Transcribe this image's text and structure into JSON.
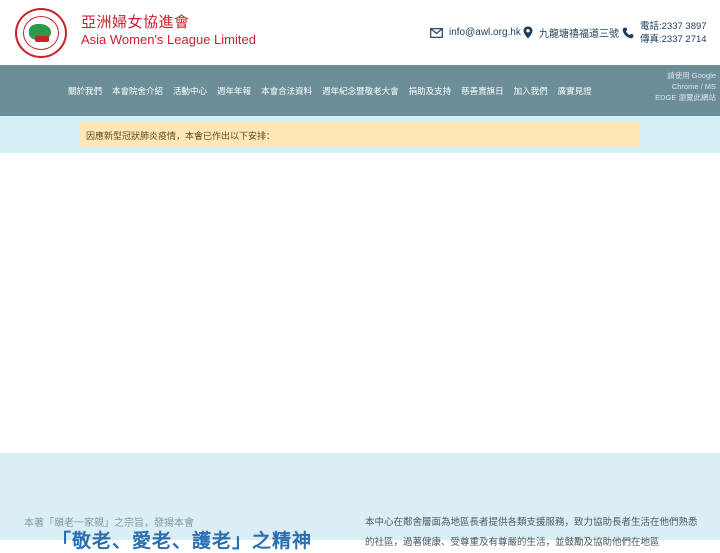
{
  "header": {
    "brand_cn": "亞洲婦女協進會",
    "brand_en": "Asia Women's League Limited",
    "logo_icon": "awl-emblem-icon",
    "email": "info@awl.org.hk",
    "address": "九龍塘禧福道三號",
    "phone": "電話:2337 3897",
    "fax": "傳真:2337 2714"
  },
  "nav": {
    "items": [
      "關於我們",
      "本會院舍介紹",
      "活動中心",
      "週年年報",
      "本會合法資料",
      "週年紀念暨敬老大會",
      "捐助及支持",
      "慈善賣旗日",
      "加入我們",
      "廣實見證"
    ],
    "browser_note": "請使用 Google Chrome / MS EDGE 瀏覽此網站"
  },
  "notice": {
    "text": "因應新型冠狀肺炎疫情，本會已作出以下安排："
  },
  "intro": {
    "left_line": "本著「頤老一家親」之宗旨，發揚本會",
    "slogan": "「敬老、愛老、護老」之精神",
    "right_text": "本中心在鄰舍層面為地區長者提供各類支援服務，致力協助長者生活在他們熟悉的社區，過著健康、受尊重及有尊嚴的生活，並鼓勵及協助他們在地區"
  },
  "colors": {
    "brand_red": "#c8202f",
    "nav_bg": "#6b8e99",
    "notice_bg": "#fde8b5",
    "band_bg": "#d5eff6",
    "slogan_blue": "#2a6fb0"
  }
}
